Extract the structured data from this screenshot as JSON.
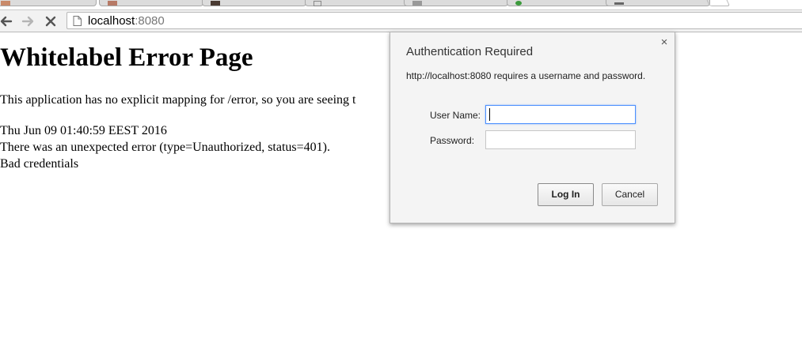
{
  "browser": {
    "url_host": "localhost",
    "url_port": ":8080"
  },
  "page": {
    "heading": "Whitelabel Error Page",
    "paragraph": "This application has no explicit mapping for /error, so you are seeing t",
    "timestamp": "Thu Jun 09 01:40:59 EEST 2016",
    "error_line": "There was an unexpected error (type=Unauthorized, status=401).",
    "message": "Bad credentials"
  },
  "dialog": {
    "title": "Authentication Required",
    "message": "http://localhost:8080 requires a username and password.",
    "close_glyph": "×",
    "username_label": "User Name:",
    "password_label": "Password:",
    "username_value": "",
    "password_value": "",
    "login_label": "Log In",
    "cancel_label": "Cancel"
  },
  "colors": {
    "focus_border": "#4d90fe",
    "page_background": "#ffffff",
    "dialog_background": "#f4f4f4"
  }
}
